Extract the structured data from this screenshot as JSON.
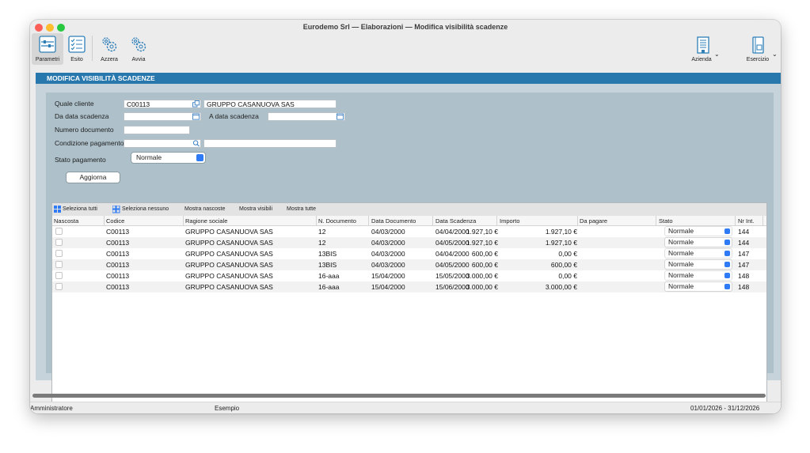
{
  "window": {
    "title": "Eurodemo Srl — Elaborazioni — Modifica visibilità scadenze"
  },
  "toolbar": {
    "parametri": "Parametri",
    "esito": "Esito",
    "azzera": "Azzera",
    "avvia": "Avvia",
    "azienda": "Azienda",
    "esercizio": "Esercizio"
  },
  "panel": {
    "title": "MODIFICA VISIBILITÀ SCADENZE"
  },
  "form": {
    "quale_cliente_label": "Quale cliente",
    "quale_cliente_code": "C00113",
    "quale_cliente_name": "GRUPPO CASANUOVA SAS",
    "da_data_label": "Da data scadenza",
    "da_data_value": "",
    "a_data_label": "A data scadenza",
    "a_data_value": "",
    "numero_documento_label": "Numero documento",
    "numero_documento_value": "",
    "condizione_label": "Condizione pagamento",
    "condizione_value": "",
    "condizione_desc": "",
    "stato_label": "Stato pagamento",
    "stato_value": "Normale",
    "aggiorna": "Aggiorna"
  },
  "table_toolbar": {
    "seleziona_tutti": "Seleziona tutti",
    "seleziona_nessuno": "Seleziona nessuno",
    "mostra_nascoste": "Mostra nascoste",
    "mostra_visibili": "Mostra visibili",
    "mostra_tutte": "Mostra tutte"
  },
  "columns": [
    "Nascosta",
    "Codice",
    "Ragione sociale",
    "N. Documento",
    "Data Documento",
    "Data Scadenza",
    "Importo",
    "Da pagare",
    "Stato",
    "Nr Int."
  ],
  "rows": [
    {
      "codice": "C00113",
      "ragione": "GRUPPO CASANUOVA SAS",
      "ndoc": "12",
      "data_doc": "04/03/2000",
      "data_scad": "04/04/2000",
      "importo": "1.927,10 €",
      "da_pagare": "1.927,10 €",
      "stato": "Normale",
      "nr": "144"
    },
    {
      "codice": "C00113",
      "ragione": "GRUPPO CASANUOVA SAS",
      "ndoc": "12",
      "data_doc": "04/03/2000",
      "data_scad": "04/05/2000",
      "importo": "1.927,10 €",
      "da_pagare": "1.927,10 €",
      "stato": "Normale",
      "nr": "144"
    },
    {
      "codice": "C00113",
      "ragione": "GRUPPO CASANUOVA SAS",
      "ndoc": "13BIS",
      "data_doc": "04/03/2000",
      "data_scad": "04/04/2000",
      "importo": "600,00 €",
      "da_pagare": "0,00 €",
      "stato": "Normale",
      "nr": "147"
    },
    {
      "codice": "C00113",
      "ragione": "GRUPPO CASANUOVA SAS",
      "ndoc": "13BIS",
      "data_doc": "04/03/2000",
      "data_scad": "04/05/2000",
      "importo": "600,00 €",
      "da_pagare": "600,00 €",
      "stato": "Normale",
      "nr": "147"
    },
    {
      "codice": "C00113",
      "ragione": "GRUPPO CASANUOVA SAS",
      "ndoc": "16-aaa",
      "data_doc": "15/04/2000",
      "data_scad": "15/05/2000",
      "importo": "3.000,00 €",
      "da_pagare": "0,00 €",
      "stato": "Normale",
      "nr": "148"
    },
    {
      "codice": "C00113",
      "ragione": "GRUPPO CASANUOVA SAS",
      "ndoc": "16-aaa",
      "data_doc": "15/04/2000",
      "data_scad": "15/06/2000",
      "importo": "3.000,00 €",
      "da_pagare": "3.000,00 €",
      "stato": "Normale",
      "nr": "148"
    }
  ],
  "statusbar": {
    "user": "Amministratore",
    "company": "Esempio",
    "period": "01/01/2026 - 31/12/2026"
  },
  "colors": {
    "accent": "#2878ad",
    "panel_bg": "#c6d3db",
    "inner_bg": "#aec1ca",
    "select_blue": "#2f7bf5"
  }
}
